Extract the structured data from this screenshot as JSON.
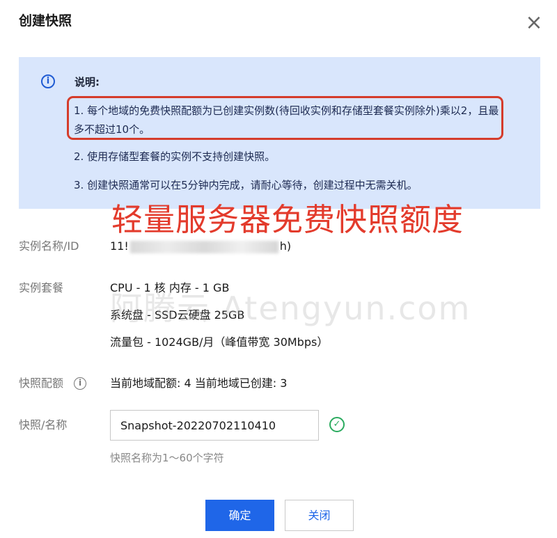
{
  "dialog": {
    "title": "创建快照",
    "close_glyph": "×"
  },
  "notice": {
    "icon": "i",
    "heading": "说明:",
    "items": [
      "1. 每个地域的免费快照配额为已创建实例数(待回收实例和存储型套餐实例除外)乘以2，且最多不超过10个。",
      "2. 使用存储型套餐的实例不支持创建快照。",
      "3. 创建快照通常可以在5分钟内完成，请耐心等待，创建过程中无需关机。"
    ]
  },
  "overlay_caption": "轻量服务器免费快照额度",
  "watermark": "阿腾云 Atengyun.com",
  "instance": {
    "label": "实例名称/ID",
    "id_prefix": "11!",
    "id_suffix": "h)"
  },
  "plan": {
    "label": "实例套餐",
    "lines": [
      "CPU - 1 核 内存 - 1 GB",
      "系统盘 - SSD云硬盘 25GB",
      "流量包 - 1024GB/月（峰值带宽 30Mbps）"
    ]
  },
  "quota": {
    "label": "快照配额",
    "help_icon": "i",
    "value": "当前地域配额: 4 当前地域已创建: 3"
  },
  "snapshot_name": {
    "label": "快照/名称",
    "value": "Snapshot-20220702110410",
    "check_glyph": "✓",
    "hint": "快照名称为1～60个字符"
  },
  "buttons": {
    "confirm": "确定",
    "close": "关闭"
  },
  "colors": {
    "notice_bg": "#d9e6fc",
    "primary": "#1f66e8",
    "highlight_border": "#d53c2b",
    "caption": "#e33b2c",
    "success": "#2bab5f"
  },
  "icons": [
    "info-icon",
    "close-icon",
    "help-icon",
    "check-circle-icon"
  ]
}
